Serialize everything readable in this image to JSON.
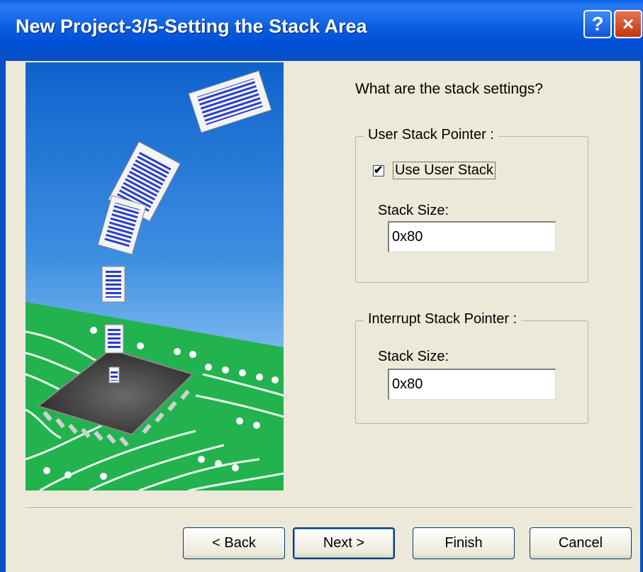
{
  "window": {
    "title": "New Project-3/5-Setting the Stack Area",
    "help_icon": "?",
    "close_icon": "×"
  },
  "prompt": "What are the stack settings?",
  "user_stack": {
    "legend": "User Stack Pointer :",
    "checkbox_label": "Use User Stack",
    "checkbox_checked": true,
    "check_glyph": "✔",
    "size_label": "Stack Size:",
    "size_value": "0x80"
  },
  "interrupt_stack": {
    "legend": "Interrupt Stack Pointer :",
    "size_label": "Stack Size:",
    "size_value": "0x80"
  },
  "buttons": {
    "back": "< Back",
    "next": "Next >",
    "finish": "Finish",
    "cancel": "Cancel"
  },
  "colors": {
    "title_bar": "#0a4fc4",
    "sky_top": "#0f62cd",
    "board": "#22b34f",
    "chip": "#3a3a3a"
  }
}
